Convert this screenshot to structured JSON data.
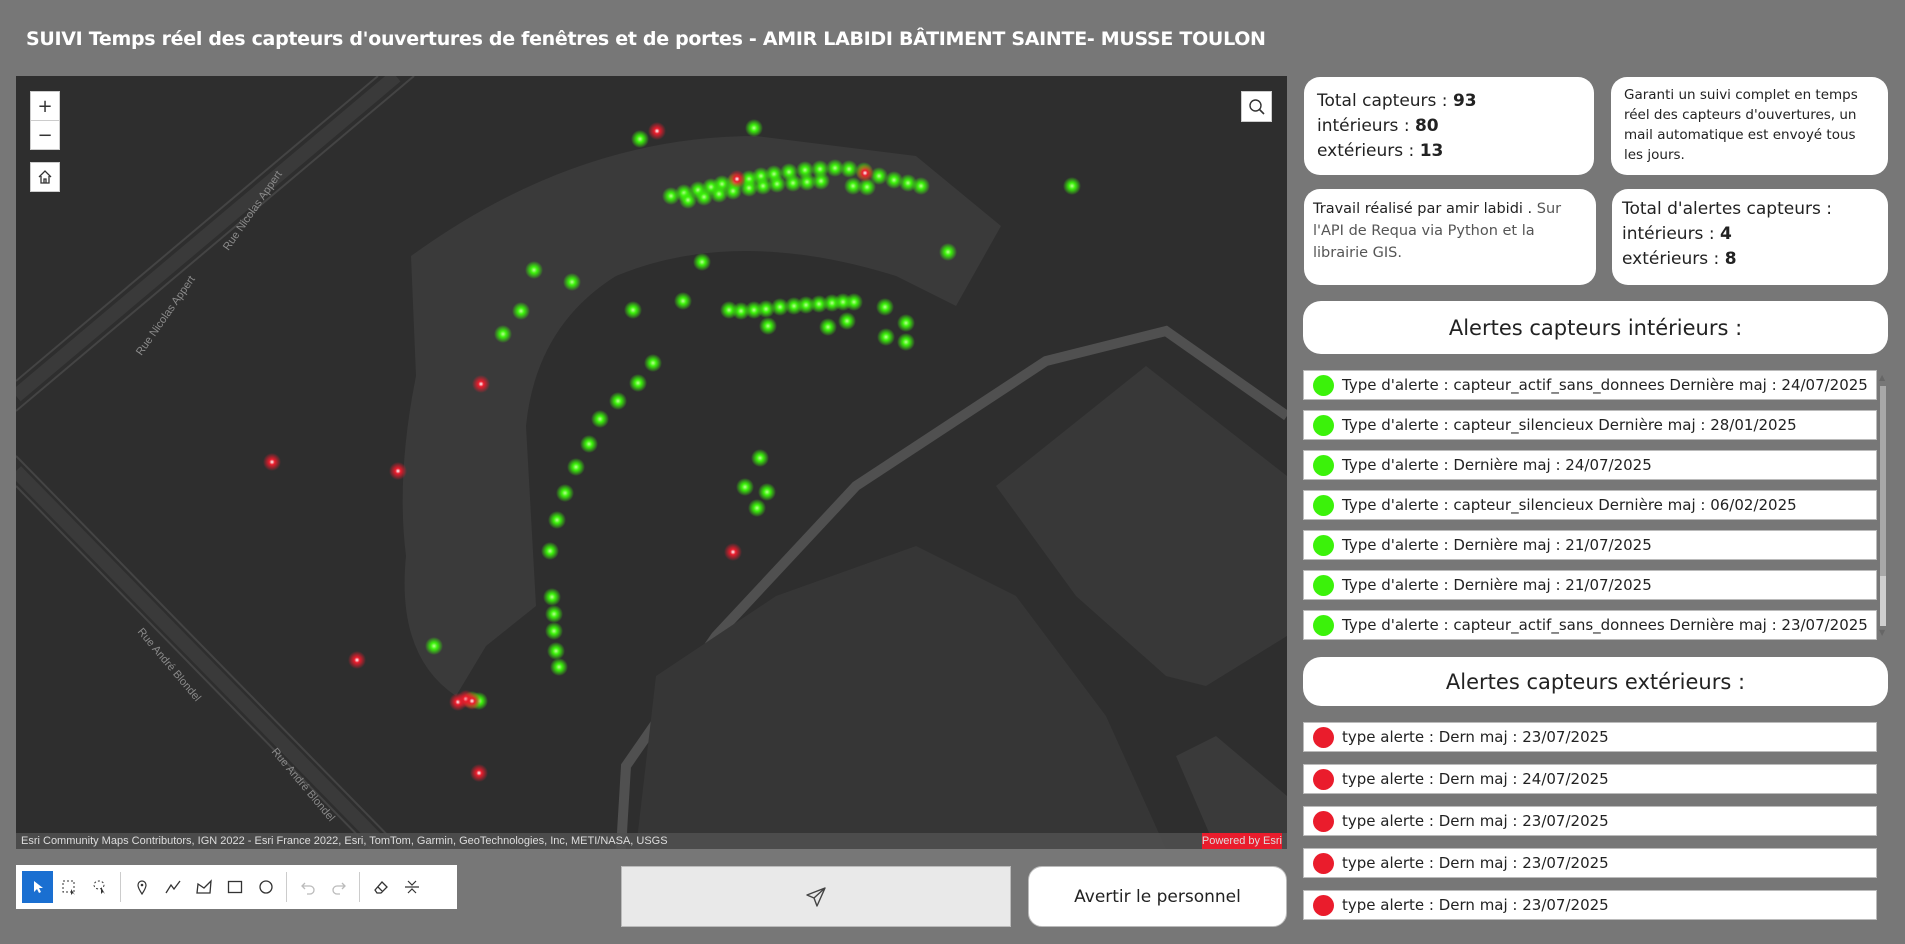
{
  "title": "SUIVI Temps réel des capteurs d'ouvertures de fenêtres et de portes  - AMIR LABIDI BÂTIMENT SAINTE- MUSSE TOULON",
  "map": {
    "zoom_in": "+",
    "zoom_out": "−",
    "attribution": "Esri Community Maps Contributors, IGN 2022 - Esri France 2022, Esri, TomTom, Garmin, GeoTechnologies, Inc, METI/NASA, USGS",
    "powered_by": "Powered by Esri",
    "streets": [
      "Rue Nicolas Appert",
      "Rue Nicolas Appert",
      "Rue André Blondel",
      "Rue André Blondel"
    ],
    "colors": {
      "ok": "#3bf20a",
      "alert": "#ea1c2c"
    }
  },
  "toolbar": {
    "tools": [
      "select-arrow-icon",
      "rectangle-select-icon",
      "lasso-select-icon",
      "point-icon",
      "polyline-icon",
      "polygon-icon",
      "rectangle-icon",
      "circle-icon",
      "undo-icon",
      "redo-icon",
      "eraser-icon",
      "collapse-icon"
    ]
  },
  "send_button": {
    "icon": "paper-plane-icon"
  },
  "warn_button": {
    "label": "Avertir le personnel"
  },
  "totals": {
    "total_label": "Total capteurs : ",
    "total_value": "93",
    "interior_label": "intérieurs : ",
    "interior_value": "80",
    "exterior_label": "extérieurs : ",
    "exterior_value": "13"
  },
  "info_text": "Garanti un suivi complet en temps réel des capteurs d'ouvertures, un mail automatique est envoyé tous les jours.",
  "credit": {
    "part1": "Travail réalisé par amir labidi .",
    "part2": " Sur l'API de Requa via Python et la librairie GIS."
  },
  "alert_totals": {
    "title": "Total d'alertes capteurs :",
    "interior_label": "intérieurs : ",
    "interior_value": "4",
    "exterior_label": "extérieurs :  ",
    "exterior_value": "8"
  },
  "interior_section": {
    "title": "Alertes capteurs intérieurs :"
  },
  "interior_alerts": [
    {
      "text": "Type d'alerte : capteur_actif_sans_donnees    Dernière maj : 24/07/2025"
    },
    {
      "text": "Type d'alerte : capteur_silencieux    Dernière maj : 28/01/2025"
    },
    {
      "text": "Type d'alerte :     Dernière maj : 24/07/2025"
    },
    {
      "text": "Type d'alerte : capteur_silencieux    Dernière maj : 06/02/2025"
    },
    {
      "text": "Type d'alerte :     Dernière maj : 21/07/2025"
    },
    {
      "text": "Type d'alerte :     Dernière maj : 21/07/2025"
    },
    {
      "text": "Type d'alerte : capteur_actif_sans_donnees    Dernière maj : 23/07/2025"
    }
  ],
  "exterior_section": {
    "title": "Alertes capteurs extérieurs :"
  },
  "exterior_alerts": [
    {
      "text": "type alerte :     Dern maj : 23/07/2025"
    },
    {
      "text": "type alerte :     Dern maj : 24/07/2025"
    },
    {
      "text": "type alerte :     Dern maj : 23/07/2025"
    },
    {
      "text": "type alerte :     Dern maj : 23/07/2025"
    },
    {
      "text": "type alerte :     Dern maj : 23/07/2025"
    }
  ]
}
